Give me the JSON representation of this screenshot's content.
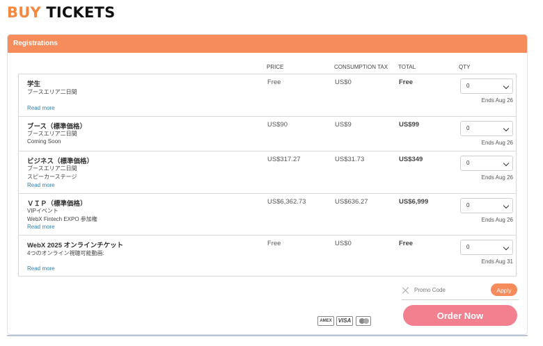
{
  "header": {
    "title_part1": "BUY",
    "title_part2": "TICKETS"
  },
  "panel": {
    "title": "Registrations"
  },
  "columns": {
    "price": "PRICE",
    "tax": "CONSUMPTION TAX",
    "total": "TOTAL",
    "qty": "QTY"
  },
  "tickets": [
    {
      "name": "学生",
      "desc1": "ブースエリア二日間",
      "desc2": "",
      "price": "Free",
      "tax": "US$0",
      "total": "Free",
      "qty": "0",
      "ends": "Ends Aug 26",
      "read_more": "Read more"
    },
    {
      "name": "ブース（標準価格）",
      "desc1": "ブースエリア二日間",
      "desc2": "Coming Soon",
      "price": "US$90",
      "tax": "US$9",
      "total": "US$99",
      "qty": "0",
      "ends": "Ends Aug 26",
      "read_more": ""
    },
    {
      "name": "ビジネス（標準価格）",
      "desc1": "ブースエリア二日間",
      "desc2": "スピーカーステージ",
      "price": "US$317.27",
      "tax": "US$31.73",
      "total": "US$349",
      "qty": "0",
      "ends": "Ends Aug 26",
      "read_more": "Read more"
    },
    {
      "name": "ＶＩＰ（標準価格）",
      "desc1": "VIPイベント",
      "desc2": "WebX Fintech EXPO 参加権",
      "price": "US$6,362.73",
      "tax": "US$636.27",
      "total": "US$6,999",
      "qty": "0",
      "ends": "Ends Aug 26",
      "read_more": "Read more"
    },
    {
      "name": "WebX 2025 オンラインチケット",
      "desc1": "4つのオンライン視聴可能動画:",
      "desc2": "",
      "price": "Free",
      "tax": "US$0",
      "total": "Free",
      "qty": "0",
      "ends": "Ends Aug 31",
      "read_more": "Read more"
    }
  ],
  "promo": {
    "label": "Promo Code",
    "apply_label": "Apply"
  },
  "payment": {
    "amex": "AMEX",
    "visa": "VISA"
  },
  "order": {
    "label": "Order Now"
  },
  "colors": {
    "accent": "#f68c5c",
    "title_orange": "#f5883e",
    "order_button": "#f3808e",
    "link": "#2f7fb5"
  }
}
